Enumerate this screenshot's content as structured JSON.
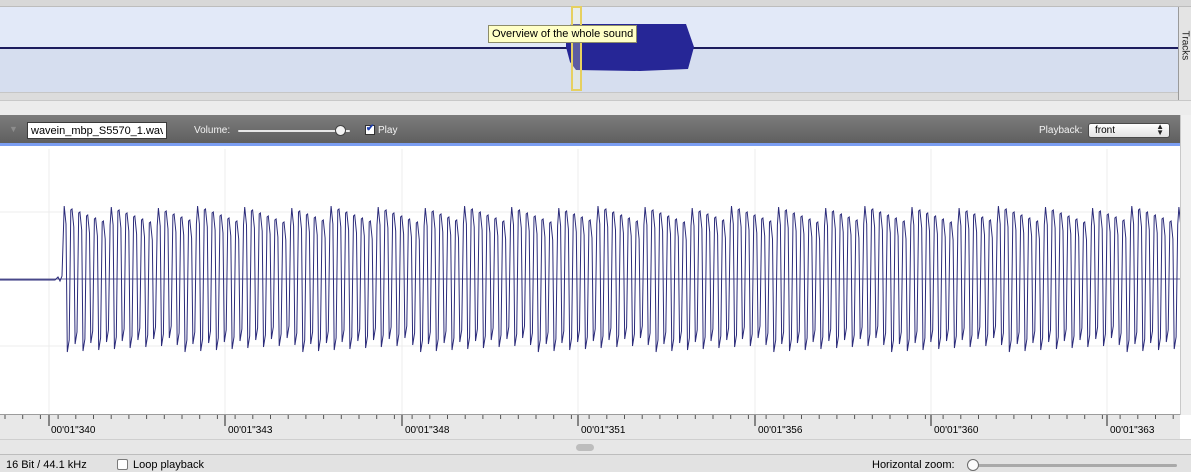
{
  "overview": {
    "tooltip": "Overview of the whole sound",
    "tracks_tab_label": "Tracks",
    "wave_color": "#262696"
  },
  "track_toolbar": {
    "track_name": "wavein_mbp_S5570_1.wav",
    "volume_label": "Volume:",
    "volume_level": 0.93,
    "play_checked": true,
    "play_label": "Play",
    "playback_label": "Playback:",
    "playback_value": "front",
    "accent_color": "#7b9ef2"
  },
  "waveform": {
    "line_color": "#2b2b7a",
    "axis_color": "#666699"
  },
  "ruler": {
    "labels": [
      "00'01\"340",
      "00'01\"343",
      "00'01\"348",
      "00'01\"351",
      "00'01\"356",
      "00'01\"360",
      "00'01\"363"
    ]
  },
  "status_bar": {
    "format": "16 Bit / 44.1 kHz",
    "loop_label": "Loop playback",
    "loop_checked": false,
    "zoom_label": "Horizontal zoom:",
    "zoom_level": 0.0
  }
}
